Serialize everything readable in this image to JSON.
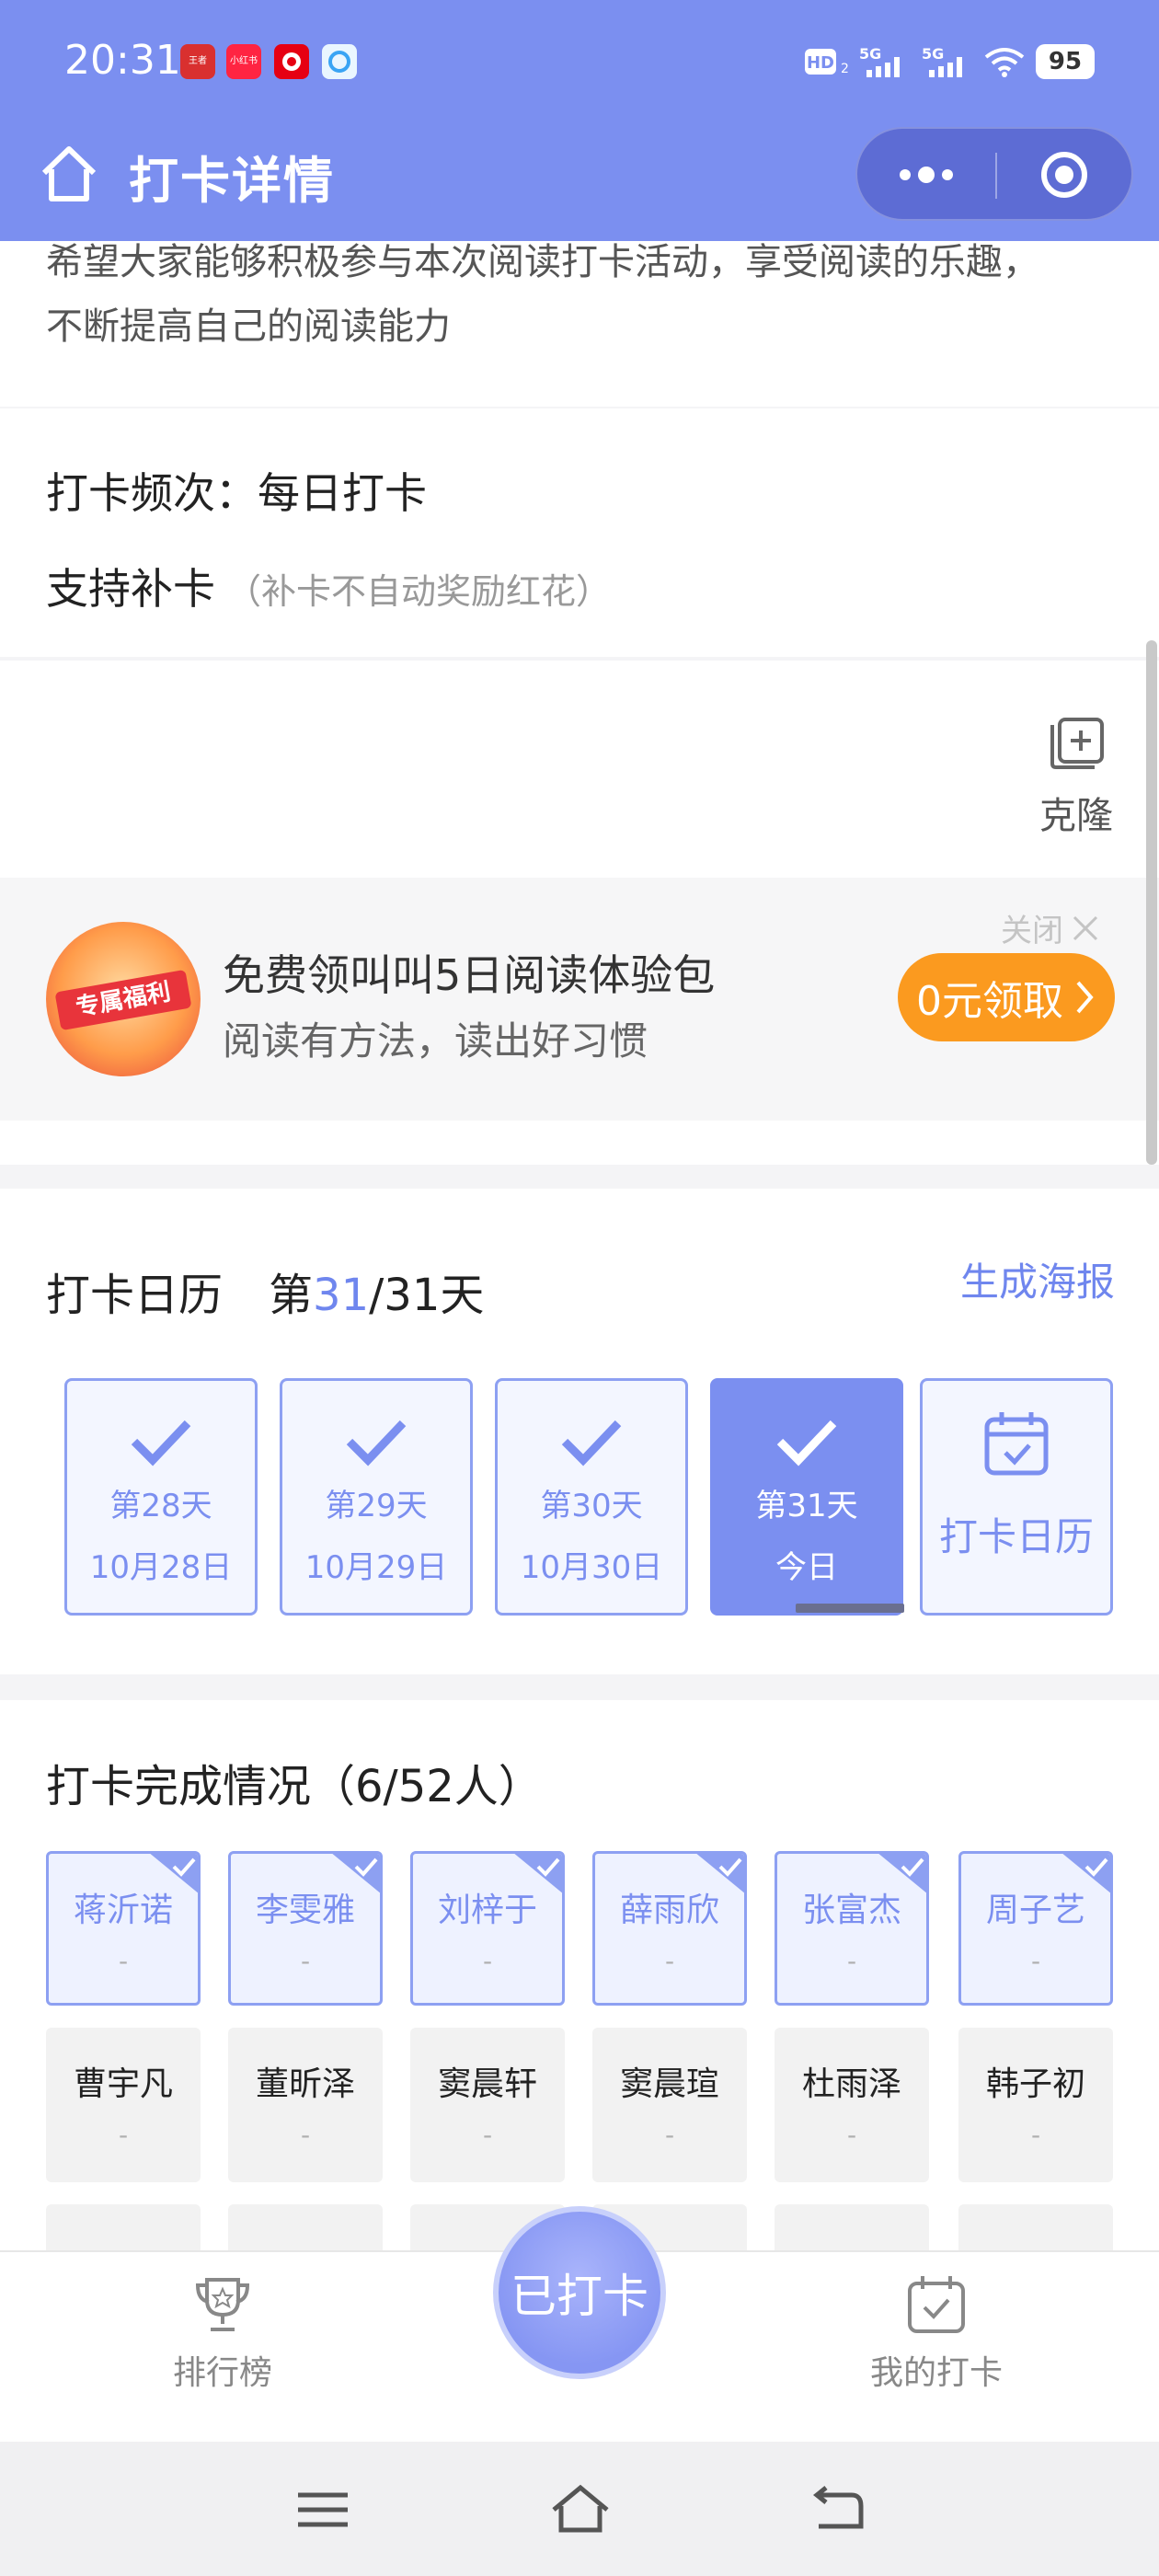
{
  "status_bar": {
    "time": "20:31",
    "notifications": [
      {
        "name": "wangzhe-app-icon",
        "label": "王者",
        "color": "#d9302f"
      },
      {
        "name": "xiaohongshu-app-icon",
        "label": "小红书",
        "color": "#ff2442"
      },
      {
        "name": "redapp-icon",
        "label": "",
        "color": "#e60012"
      },
      {
        "name": "browser-app-icon",
        "label": "",
        "color": "#3aa4f4"
      }
    ],
    "signal_labels": [
      "HD",
      "5G",
      "5G"
    ],
    "battery": "95"
  },
  "titlebar": {
    "title": "打卡详情"
  },
  "description": {
    "line1": "希望大家能够积极参与本次阅读打卡活动，享受阅读的乐趣，",
    "line2": "不断提高自己的阅读能力"
  },
  "settings": {
    "frequency": "打卡频次：每日打卡",
    "makeup": "支持补卡",
    "makeup_note": "（补卡不自动奖励红花）"
  },
  "clone": {
    "label": "克隆"
  },
  "promo": {
    "badge_text": "专属福利",
    "title": "免费领叫叫5日阅读体验包",
    "subtitle": "阅读有方法，读出好习惯",
    "close_label": "关闭",
    "cta": "0元领取"
  },
  "calendar": {
    "title": "打卡日历",
    "day_prefix": "第",
    "current_day": "31",
    "total_suffix": "/31天",
    "poster_link": "生成海报",
    "days": [
      {
        "label": "第28天",
        "date": "10月28日",
        "checked": true,
        "today": false
      },
      {
        "label": "第29天",
        "date": "10月29日",
        "checked": true,
        "today": false
      },
      {
        "label": "第30天",
        "date": "10月30日",
        "checked": true,
        "today": false
      },
      {
        "label": "第31天",
        "date": "今日",
        "checked": true,
        "today": true
      }
    ],
    "calendar_button": "打卡日历"
  },
  "completion": {
    "title": "打卡完成情况（6/52人）",
    "done_members": [
      {
        "name": "蒋沂诺",
        "status": "-"
      },
      {
        "name": "李雯雅",
        "status": "-"
      },
      {
        "name": "刘梓于",
        "status": "-"
      },
      {
        "name": "薛雨欣",
        "status": "-"
      },
      {
        "name": "张富杰",
        "status": "-"
      },
      {
        "name": "周子艺",
        "status": "-"
      }
    ],
    "pending_members": [
      {
        "name": "曹宇凡",
        "status": "-"
      },
      {
        "name": "董昕泽",
        "status": "-"
      },
      {
        "name": "窦晨轩",
        "status": "-"
      },
      {
        "name": "窦晨瑄",
        "status": "-"
      },
      {
        "name": "杜雨泽",
        "status": "-"
      },
      {
        "name": "韩子初",
        "status": "-"
      }
    ]
  },
  "tabbar": {
    "ranking": "排行榜",
    "checkin": "已打卡",
    "my_checkin": "我的打卡"
  }
}
